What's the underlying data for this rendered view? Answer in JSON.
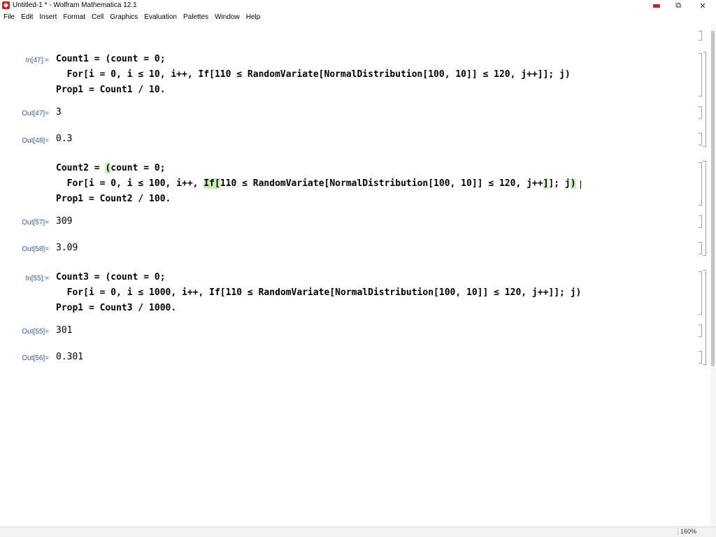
{
  "window": {
    "title": "Untitled-1 * - Wolfram Mathematica 12.1",
    "minimize_icon": "minimize-icon",
    "maximize_icon": "maximize-icon",
    "maximize_glyph": "⧉",
    "close_icon": "close-icon",
    "close_glyph": "✕"
  },
  "menu": [
    "File",
    "Edit",
    "Insert",
    "Format",
    "Cell",
    "Graphics",
    "Evaluation",
    "Palettes",
    "Window",
    "Help"
  ],
  "cells": {
    "in47": {
      "label": "In[47]:=",
      "line1": "Count1 = (count = 0;",
      "line2": "  For[i = 0, i ≤ 10, i++, If[110 ≤ RandomVariate[NormalDistribution[100, 10]] ≤ 120, j++]]; j)",
      "line3": "Prop1 = Count1 / 10."
    },
    "out47": {
      "label": "Out[47]=",
      "value": "3"
    },
    "out48": {
      "label": "Out[48]=",
      "value": "0.3"
    },
    "in_count2": {
      "line1_pre": "Count2 = ",
      "line1_hl": "(",
      "line1_post": "count = 0;",
      "line2_pre": "  For[i = 0, i ≤ 100, i++, ",
      "line2_hl": "If[",
      "line2_mid": "110 ≤ RandomVariate[NormalDistribution[100, 10]] ≤ 120, j++",
      "line2_hl2": "]",
      "line2_mid2": "]; j",
      "line2_hl3": ")",
      "line3": "Prop1 = Count2 / 100."
    },
    "out57": {
      "label": "Out[57]=",
      "value": "309"
    },
    "out58": {
      "label": "Out[58]=",
      "value": "3.09"
    },
    "in55": {
      "label": "In[55]:=",
      "line1": "Count3 = (count = 0;",
      "line2": "  For[i = 0, i ≤ 1000, i++, If[110 ≤ RandomVariate[NormalDistribution[100, 10]] ≤ 120, j++]]; j)",
      "line3": "Prop1 = Count3 / 1000."
    },
    "out55": {
      "label": "Out[55]=",
      "value": "301"
    },
    "out56": {
      "label": "Out[56]=",
      "value": "0.301"
    }
  },
  "status": {
    "zoom": "160%"
  }
}
